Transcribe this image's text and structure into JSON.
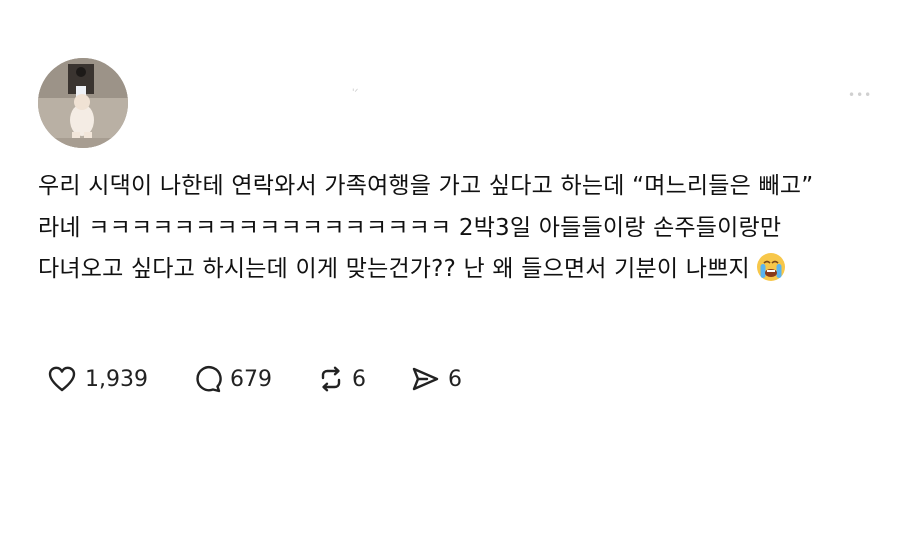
{
  "post": {
    "text": "우리 시댁이 나한테 연락와서 가족여행을 가고 싶다고 하는데 “며느리들은 빼고” 라네 ㅋㅋㅋㅋㅋㅋㅋㅋㅋㅋㅋㅋㅋㅋㅋㅋㅋ 2박3일 아들들이랑 손주들이랑만 다녀오고 싶다고 하시는데 이게 맞는건가?? 난 왜 들으면서 기분이 나쁘지",
    "emoji": "crying-face"
  },
  "header": {
    "username": "'ᐟ",
    "more": "•••"
  },
  "actions": {
    "likes": "1,939",
    "replies": "679",
    "reposts": "6",
    "shares": "6"
  }
}
